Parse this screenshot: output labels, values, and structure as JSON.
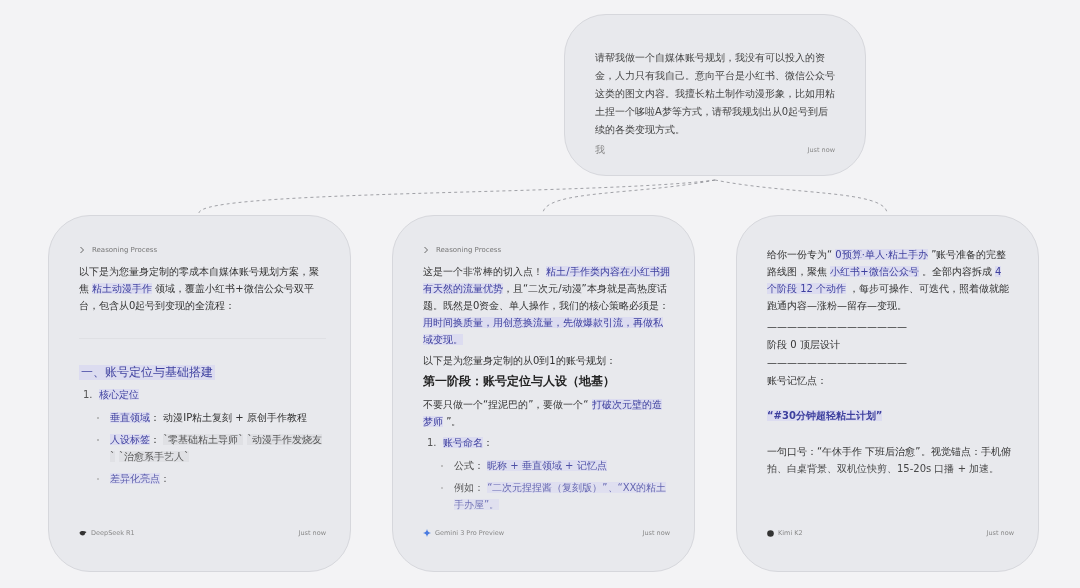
{
  "prompt_card": {
    "text": "请帮我做一个自媒体账号规划，我没有可以投入的资金，人力只有我自己。意向平台是小红书、微信公众号这类的图文内容。我擅长粘土制作动漫形象，比如用粘土捏一个哆啦A梦等方式，请帮我规划出从0起号到后续的各类变现方式。",
    "author": "我",
    "time": "Just now"
  },
  "responses": [
    {
      "model": "DeepSeek R1",
      "time": "Just now",
      "blocks": [
        {
          "kind": "reasoning",
          "text": "Reasoning Process"
        },
        {
          "kind": "para",
          "segs": [
            {
              "t": "以下是为您量身定制的零成本自媒体账号规划方案，聚焦 ",
              "kind": "plain"
            },
            {
              "t": "粘土动漫手作",
              "kind": "mark"
            },
            {
              "t": " 领域，覆盖小红书+微信公众号双平台，包含从0起号到变现的全流程：",
              "kind": "plain"
            }
          ]
        },
        {
          "kind": "divider"
        },
        {
          "kind": "heading",
          "text": "一、账号定位与基础搭建"
        },
        {
          "kind": "numbered",
          "num": "1.",
          "segs": [
            {
              "t": "核心定位",
              "kind": "mark"
            }
          ]
        },
        {
          "kind": "bullet",
          "segs": [
            {
              "t": "垂直领域",
              "kind": "mark"
            },
            {
              "t": "： 动漫IP粘土复刻 + 原创手作教程",
              "kind": "plain"
            }
          ]
        },
        {
          "kind": "bullet",
          "segs": [
            {
              "t": "人设标签",
              "kind": "mark"
            },
            {
              "t": "： ",
              "kind": "plain"
            },
            {
              "t": "`零基础粘土导师`",
              "kind": "tag"
            },
            {
              "t": "`动漫手作发烧友`",
              "kind": "tag"
            },
            {
              "t": "`治愈系手艺人`",
              "kind": "tag"
            }
          ]
        },
        {
          "kind": "bullet",
          "segs": [
            {
              "t": "差异化亮点",
              "kind": "mark"
            },
            {
              "t": "：",
              "kind": "plain"
            }
          ]
        }
      ]
    },
    {
      "model": "Gemini 3 Pro Preview",
      "time": "Just now",
      "blocks": [
        {
          "kind": "reasoning",
          "text": "Reasoning Process"
        },
        {
          "kind": "para",
          "segs": [
            {
              "t": "这是一个非常棒的切入点！ ",
              "kind": "plain"
            },
            {
              "t": "粘土/手作类内容在小红书拥有天然的流量优势",
              "kind": "mark"
            },
            {
              "t": "，且“二次元/动漫”本身就是高热度话题。既然是0资金、单人操作，我们的核心策略必须是： ",
              "kind": "plain"
            },
            {
              "t": "用时间换质量，用创意换流量，先做爆款引流，再做私域变现。",
              "kind": "mark"
            }
          ]
        },
        {
          "kind": "para",
          "segs": [
            {
              "t": "以下是为您量身定制的从0到1的账号规划：",
              "kind": "plain"
            }
          ]
        },
        {
          "kind": "title",
          "text": "第一阶段：账号定位与人设（地基）"
        },
        {
          "kind": "para",
          "segs": [
            {
              "t": "不要只做一个“捏泥巴的”，要做一个“ ",
              "kind": "plain"
            },
            {
              "t": "打破次元壁的造梦师",
              "kind": "mark"
            },
            {
              "t": " ”。",
              "kind": "plain"
            }
          ]
        },
        {
          "kind": "numbered",
          "num": "1.",
          "segs": [
            {
              "t": "账号命名",
              "kind": "mark"
            },
            {
              "t": "：",
              "kind": "plain"
            }
          ]
        },
        {
          "kind": "bullet",
          "segs": [
            {
              "t": "公式： ",
              "kind": "plain"
            },
            {
              "t": "昵称 + 垂直领域 + 记忆点",
              "kind": "mark"
            }
          ]
        },
        {
          "kind": "bullet",
          "segs": [
            {
              "t": "例如： ",
              "kind": "plain"
            },
            {
              "t": "“二次元捏捏酱（复刻版）”、“XX的粘土手办屋”。",
              "kind": "mark"
            }
          ]
        }
      ]
    },
    {
      "model": "Kimi K2",
      "time": "Just now",
      "blocks": [
        {
          "kind": "para",
          "segs": [
            {
              "t": "给你一份专为“ ",
              "kind": "plain"
            },
            {
              "t": "0预算·单人·粘土手办",
              "kind": "mark"
            },
            {
              "t": " ”账号准备的完整路线图，聚焦 ",
              "kind": "plain"
            },
            {
              "t": "小红书+微信公众号",
              "kind": "mark"
            },
            {
              "t": " 。全部内容拆成 ",
              "kind": "plain"
            },
            {
              "t": "4 个阶段 12 个动作",
              "kind": "mark"
            },
            {
              "t": " ，每步可操作、可迭代，照着做就能跑通内容—涨粉—留存—变现。",
              "kind": "plain"
            }
          ]
        },
        {
          "kind": "line",
          "text": "——————————————"
        },
        {
          "kind": "line",
          "text": "阶段 0 顶层设计"
        },
        {
          "kind": "line",
          "text": "——————————————"
        },
        {
          "kind": "line",
          "text": "账号记忆点："
        },
        {
          "kind": "callout",
          "text": "“#30分钟超轻粘土计划”"
        },
        {
          "kind": "para",
          "segs": [
            {
              "t": "一句口号：“午休手作 下班后治愈”。视觉锚点：手机俯拍、白桌背景、双机位快剪、15-20s 口播 + 加速。",
              "kind": "plain"
            }
          ]
        }
      ]
    }
  ]
}
